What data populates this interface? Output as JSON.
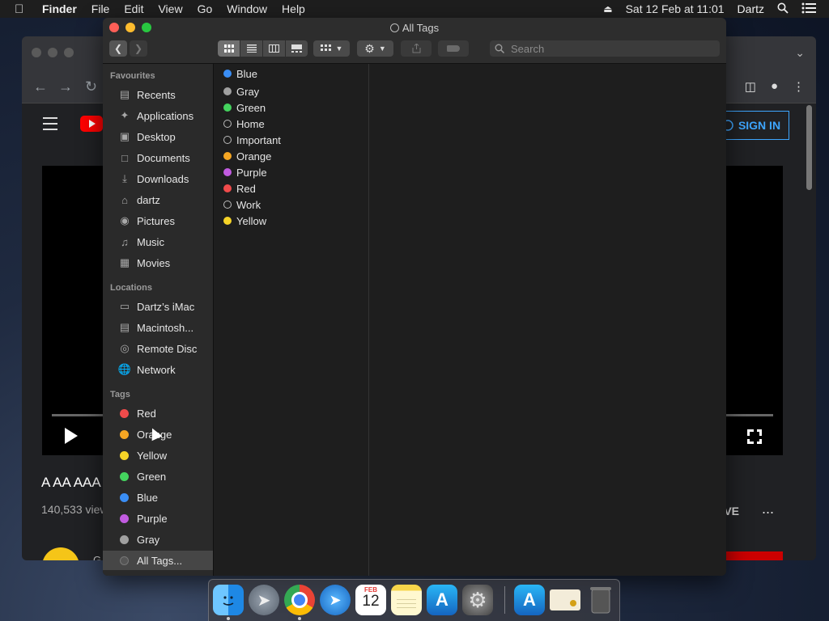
{
  "menubar": {
    "app": "Finder",
    "items": [
      "File",
      "Edit",
      "View",
      "Go",
      "Window",
      "Help"
    ],
    "datetime": "Sat 12 Feb at 11:01",
    "user": "Dartz"
  },
  "browser": {
    "sign_in": "SIGN IN",
    "video_title": "A AA AAA",
    "views": "140,533 view",
    "save": "VE",
    "more": "...",
    "channel": "G"
  },
  "finder": {
    "title": "All Tags",
    "search_placeholder": "Search",
    "sidebar": {
      "favourites_heading": "Favourites",
      "favourites": [
        {
          "label": "Recents",
          "icon": "clock-icon"
        },
        {
          "label": "Applications",
          "icon": "applications-icon"
        },
        {
          "label": "Desktop",
          "icon": "desktop-icon"
        },
        {
          "label": "Documents",
          "icon": "document-icon"
        },
        {
          "label": "Downloads",
          "icon": "download-icon"
        },
        {
          "label": "dartz",
          "icon": "home-icon"
        },
        {
          "label": "Pictures",
          "icon": "camera-icon"
        },
        {
          "label": "Music",
          "icon": "music-note-icon"
        },
        {
          "label": "Movies",
          "icon": "film-icon"
        }
      ],
      "locations_heading": "Locations",
      "locations": [
        {
          "label": "Dartz’s iMac",
          "icon": "imac-icon"
        },
        {
          "label": "Macintosh...",
          "icon": "hard-drive-icon"
        },
        {
          "label": "Remote Disc",
          "icon": "disc-icon"
        },
        {
          "label": "Network",
          "icon": "globe-icon"
        }
      ],
      "tags_heading": "Tags",
      "tags": [
        {
          "label": "Red",
          "color": "#f04b4b"
        },
        {
          "label": "Orange",
          "color": "#f5a623"
        },
        {
          "label": "Yellow",
          "color": "#f5d327"
        },
        {
          "label": "Green",
          "color": "#44d35e"
        },
        {
          "label": "Blue",
          "color": "#3a8ef5"
        },
        {
          "label": "Purple",
          "color": "#c15be0"
        },
        {
          "label": "Gray",
          "color": "#a0a0a0"
        },
        {
          "label": "All Tags...",
          "color": "#555555"
        }
      ]
    },
    "column_tags": [
      {
        "label": "Blue",
        "color": "#3a8ef5"
      },
      {
        "label": "Gray",
        "color": "#a0a0a0"
      },
      {
        "label": "Green",
        "color": "#44d35e"
      },
      {
        "label": "Home",
        "color": ""
      },
      {
        "label": "Important",
        "color": ""
      },
      {
        "label": "Orange",
        "color": "#f5a623"
      },
      {
        "label": "Purple",
        "color": "#c15be0"
      },
      {
        "label": "Red",
        "color": "#f04b4b"
      },
      {
        "label": "Work",
        "color": ""
      },
      {
        "label": "Yellow",
        "color": "#f5d327"
      }
    ]
  },
  "dock": {
    "calendar_month": "FEB",
    "calendar_day": "12"
  }
}
